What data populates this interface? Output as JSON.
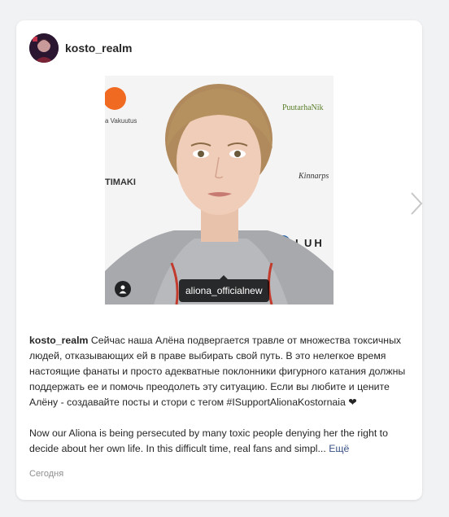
{
  "post": {
    "username": "kosto_realm",
    "photo_tag": "aliona_officialnew",
    "caption_user": "kosto_realm",
    "caption_ru": "Сейчас наша Алёна подвергается травле от множества токсичных людей, отказывающих ей в праве выбирать свой путь. В это нелегкое время настоящие фанаты и просто адекватные поклонники фигурного катания должны поддержать ее и помочь преодолеть эту ситуацию. Если вы любите и цените Алёну - создавайте посты и стори с тегом #ISupportAlionaKostornaia ❤",
    "caption_en": "Now our Aliona is being persecuted by many toxic people denying her the right to decide about her own life. In this difficult time, real fans and simpl...",
    "more_label": "Ещё",
    "date": "Сегодня"
  },
  "photo_backdrop_text": {
    "brand_left": "a Vakuutus",
    "brand_right_top": "PuutarhaNik",
    "brand_mid_left": "TIMAKI",
    "brand_mid_right": "Kinnarps",
    "brand_bottom_right": "LUH"
  },
  "icons": {
    "user_tag": "person-icon",
    "next": "chevron-right-icon"
  }
}
